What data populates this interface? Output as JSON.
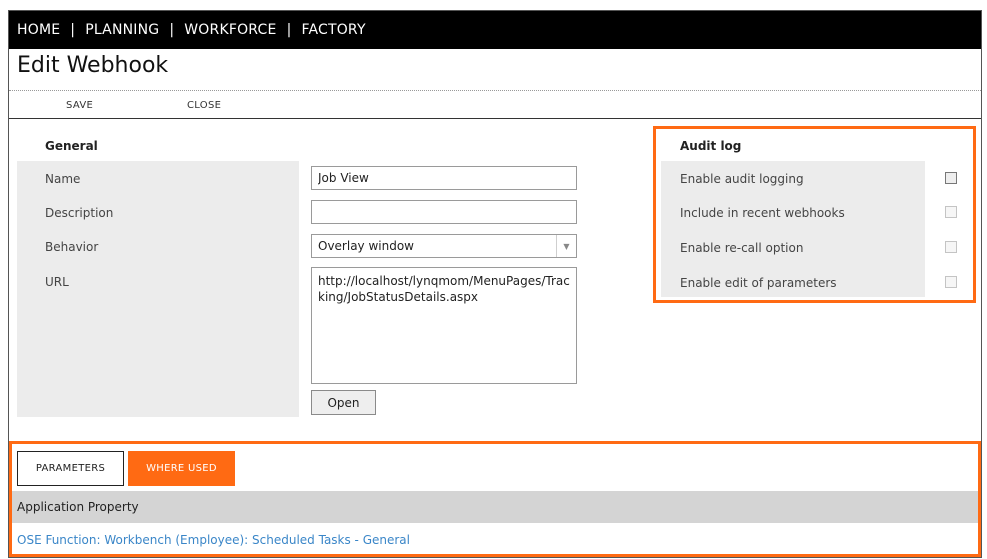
{
  "nav": {
    "items": [
      "HOME",
      "PLANNING",
      "WORKFORCE",
      "FACTORY"
    ],
    "separator": "|"
  },
  "page": {
    "title": "Edit Webhook"
  },
  "toolbar": {
    "save_label": "SAVE",
    "close_label": "CLOSE"
  },
  "general": {
    "heading": "General",
    "name_label": "Name",
    "name_value": "Job View",
    "description_label": "Description",
    "description_value": "",
    "behavior_label": "Behavior",
    "behavior_value": "Overlay window",
    "url_label": "URL",
    "url_value": "http://localhost/lynqmom/MenuPages/Tracking/JobStatusDetails.aspx",
    "open_label": "Open"
  },
  "audit": {
    "heading": "Audit log",
    "options": [
      {
        "label": "Enable audit logging",
        "checked": false
      },
      {
        "label": "Include in recent webhooks",
        "checked": false
      },
      {
        "label": "Enable re-call option",
        "checked": false
      },
      {
        "label": "Enable edit of parameters",
        "checked": false
      }
    ]
  },
  "tabs": {
    "parameters_label": "PARAMETERS",
    "where_used_label": "WHERE USED",
    "active": "WHERE USED"
  },
  "where_used": {
    "column_header": "Application Property",
    "rows": [
      "OSE Function: Workbench (Employee): Scheduled Tasks - General"
    ]
  },
  "colors": {
    "accent": "#ff6a13",
    "link": "#3a86c8",
    "nav_bg": "#000000"
  }
}
